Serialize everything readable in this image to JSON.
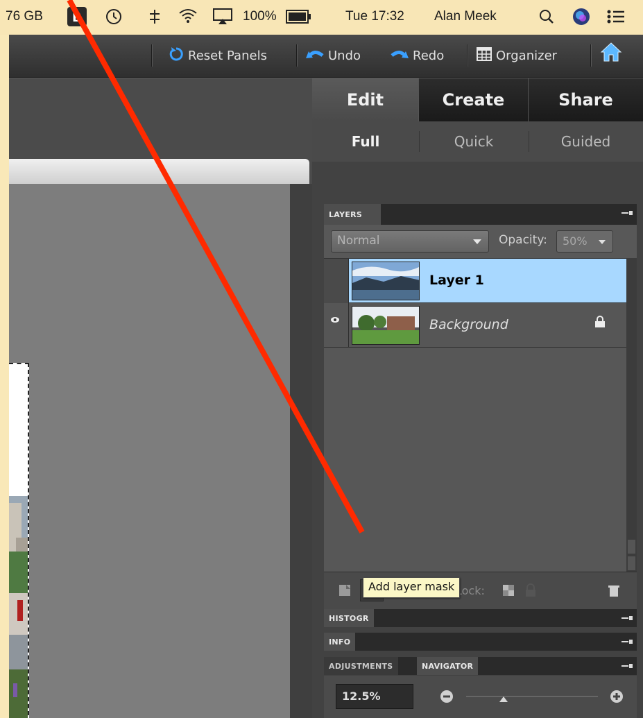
{
  "menubar": {
    "disk": "76 GB",
    "battery": "100%",
    "clock": "Tue 17:32",
    "user": "Alan Meek"
  },
  "toolbar": {
    "reset_label": "Reset Panels",
    "undo_label": "Undo",
    "redo_label": "Redo",
    "organizer_label": "Organizer"
  },
  "panel": {
    "main_tabs": [
      "Edit",
      "Create",
      "Share"
    ],
    "active_main_tab": "Edit",
    "sub_tabs": [
      "Full",
      "Quick",
      "Guided"
    ],
    "active_sub_tab": "Full",
    "layers": {
      "title": "LAYERS",
      "blend_mode": "Normal",
      "opacity_label": "Opacity:",
      "opacity_value": "50%",
      "items": [
        {
          "name": "Layer 1",
          "selected": true,
          "visible": false,
          "locked": false
        },
        {
          "name": "Background",
          "selected": false,
          "visible": true,
          "locked": true
        }
      ],
      "lock_label": "Lock:"
    },
    "tooltip": "Add layer mask",
    "histogram_tab": "HISTOGR",
    "info_tab": "INFO",
    "adjustments_tab": "ADJUSTMENTS",
    "navigator_tab": "NAVIGATOR",
    "zoom_value": "12.5%"
  },
  "colors": {
    "annotation_arrow": "#ff2a00",
    "selected_layer": "#a8d8ff",
    "tooltip_bg": "#fbf7c6",
    "background_frame": "#f9e8b8"
  }
}
